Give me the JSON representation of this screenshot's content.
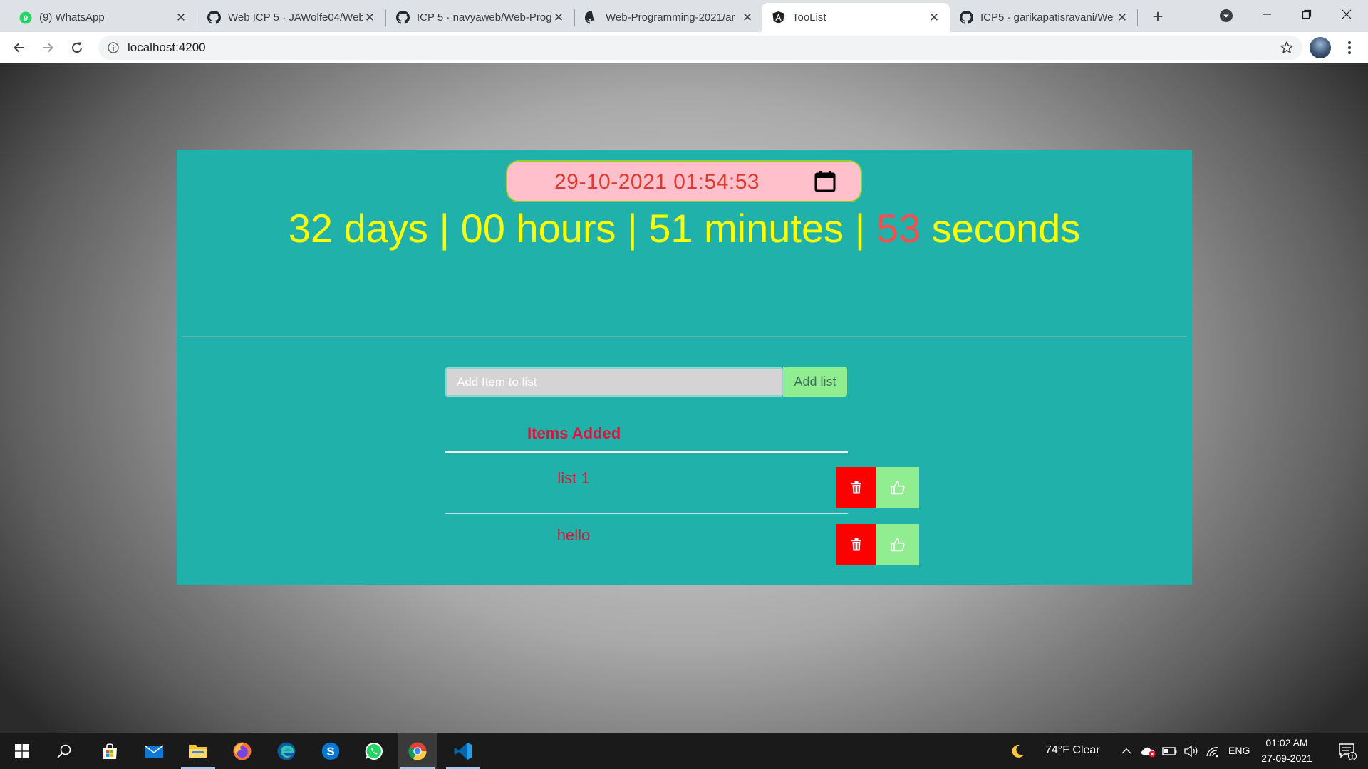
{
  "browser": {
    "tabs": [
      {
        "title": "(9) WhatsApp",
        "active": false
      },
      {
        "title": "Web ICP 5 · JAWolfe04/Web-",
        "active": false
      },
      {
        "title": "ICP 5 · navyaweb/Web-Prog",
        "active": false
      },
      {
        "title": "Web-Programming-2021/ar",
        "active": false
      },
      {
        "title": "TooList",
        "active": true
      },
      {
        "title": "ICP5 · garikapatisravani/We",
        "active": false
      }
    ],
    "whatsapp_badge": "9",
    "url": "localhost:4200"
  },
  "page": {
    "datetime_value": "29-10-2021 01:54:53",
    "countdown": {
      "days": "32 days",
      "hours": "00 hours",
      "minutes": "51 minutes",
      "seconds_value": "53",
      "seconds_unit": "seconds",
      "separator": "|"
    },
    "add_input_placeholder": "Add Item to list",
    "add_button_label": "Add list",
    "items_header": "Items Added",
    "items": [
      {
        "text": "list 1"
      },
      {
        "text": "hello"
      }
    ],
    "colors": {
      "panel": "#20b2aa",
      "countdown_text": "#ffff00",
      "seconds_value": "#ff4c4c",
      "item_text": "#dc143c",
      "delete_button": "#ff0000",
      "like_button": "#90ee90",
      "date_pill_bg": "#ffc0cb"
    }
  },
  "taskbar": {
    "weather": "74°F  Clear",
    "language": "ENG",
    "time": "01:02 AM",
    "date": "27-09-2021",
    "notification_count": "1"
  }
}
